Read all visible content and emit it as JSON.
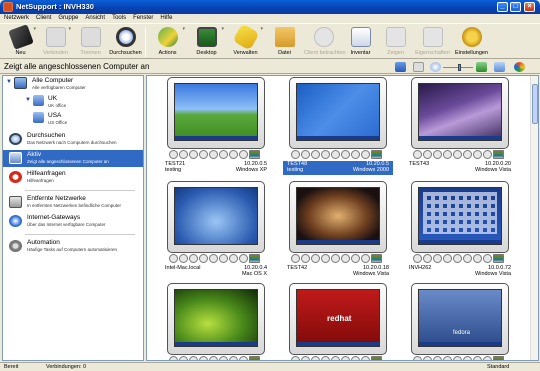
{
  "window": {
    "title": "NetSupport : INVH330"
  },
  "menu": [
    "Netzwerk",
    "Client",
    "Gruppe",
    "Ansicht",
    "Tools",
    "Fenster",
    "Hilfe"
  ],
  "toolbar": [
    {
      "label": "Neu",
      "icon": "new-icon",
      "enabled": true
    },
    {
      "label": "Verbinden",
      "icon": "connect-icon",
      "enabled": false
    },
    {
      "label": "Trennen",
      "icon": "disconnect-icon",
      "enabled": false
    },
    {
      "label": "Durchsuchen",
      "icon": "browse-icon",
      "enabled": true
    },
    {
      "label": "Actions",
      "icon": "actions-icon",
      "enabled": true
    },
    {
      "label": "Desktop",
      "icon": "desktop-icon",
      "enabled": true
    },
    {
      "label": "Verwalten",
      "icon": "manage-icon",
      "enabled": true
    },
    {
      "label": "Datei",
      "icon": "file-icon",
      "enabled": true
    },
    {
      "label": "Client betrachten",
      "icon": "view-client-icon",
      "enabled": false
    },
    {
      "label": "Inventar",
      "icon": "inventory-icon",
      "enabled": true
    },
    {
      "label": "Zeigen",
      "icon": "show-icon",
      "enabled": false
    },
    {
      "label": "Eigenschaften",
      "icon": "properties-icon",
      "enabled": false
    },
    {
      "label": "Einstellungen",
      "icon": "settings-icon",
      "enabled": true
    }
  ],
  "header": {
    "title": "Zeigt alle angeschlossenen Computer an"
  },
  "sidebar": {
    "alle": {
      "title": "Alle Computer",
      "desc": "Alle verfügbaren Computer"
    },
    "uk": {
      "title": "UK",
      "desc": "UK office"
    },
    "usa": {
      "title": "USA",
      "desc": "US Office"
    },
    "durchsuchen": {
      "title": "Durchsuchen",
      "desc": "Das Netzwerk nach Computern durchsuchen"
    },
    "aktiv": {
      "title": "Aktiv",
      "desc": "Zeigt alle angeschlossenen Computer an"
    },
    "hilfe": {
      "title": "Hilfeanfragen",
      "desc": "Hilfeanfragen"
    },
    "entfernt": {
      "title": "Entfernte Netzwerke",
      "desc": "In entfernten Netzwerken befindliche Computer"
    },
    "gateways": {
      "title": "Internet-Gateways",
      "desc": "Über das Internet verfügbare Computer"
    },
    "automation": {
      "title": "Automation",
      "desc": "Häufige Tasks auf Computern automatisieren"
    }
  },
  "clients": [
    {
      "name": "TEST21",
      "ip": "10.20.0.5",
      "user": "testing",
      "os": "Windows XP",
      "selected": false,
      "screen": "xp"
    },
    {
      "name": "TEST48",
      "ip": "10.20.0.5",
      "user": "testing",
      "os": "Windows 2000",
      "selected": true,
      "screen": "w2k"
    },
    {
      "name": "TEST43",
      "ip": "10.20.0.20",
      "user": "",
      "os": "Windows Vista",
      "selected": false,
      "screen": "vista"
    },
    {
      "name": "Intel-Mac.local",
      "ip": "10.20.0.4",
      "user": "",
      "os": "Mac OS X",
      "selected": false,
      "screen": "mac"
    },
    {
      "name": "TEST42",
      "ip": "10.20.0.18",
      "user": "",
      "os": "Windows Vista",
      "selected": false,
      "screen": "vista2"
    },
    {
      "name": "INVH262",
      "ip": "10.0.0.72",
      "user": "",
      "os": "Windows Vista",
      "selected": false,
      "screen": "icons"
    },
    {
      "name": "",
      "ip": "",
      "user": "",
      "os": "",
      "selected": false,
      "screen": "green"
    },
    {
      "name": "",
      "ip": "",
      "user": "",
      "os": "",
      "selected": false,
      "screen": "redhat"
    },
    {
      "name": "",
      "ip": "",
      "user": "",
      "os": "",
      "selected": false,
      "screen": "fedora"
    }
  ],
  "screen_text": {
    "redhat": "redhat",
    "fedora": "fedora"
  },
  "status": {
    "left": "Bereit",
    "connections": "Verbindungen: 0",
    "mode": "Standard"
  }
}
